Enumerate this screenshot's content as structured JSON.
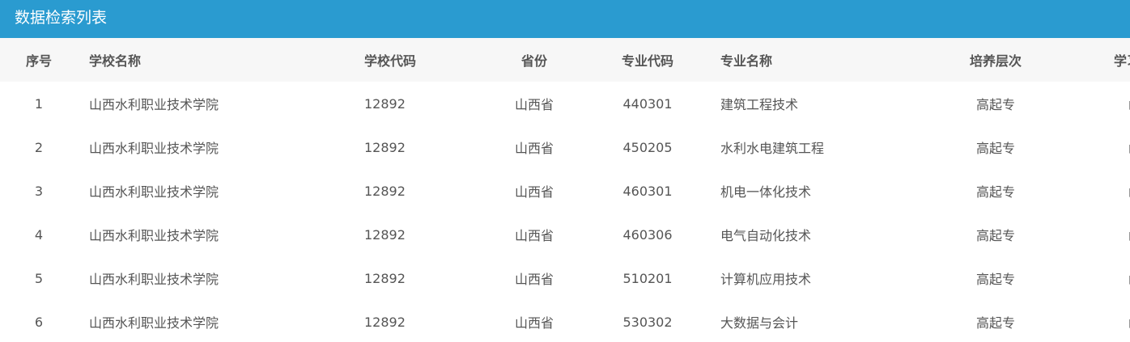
{
  "panel": {
    "title": "数据检索列表"
  },
  "table": {
    "headers": [
      "序号",
      "学校名称",
      "学校代码",
      "省份",
      "专业代码",
      "专业名称",
      "培养层次",
      "学习形式"
    ],
    "rows": [
      [
        "1",
        "山西水利职业技术学院",
        "12892",
        "山西省",
        "440301",
        "建筑工程技术",
        "高起专",
        "函授"
      ],
      [
        "2",
        "山西水利职业技术学院",
        "12892",
        "山西省",
        "450205",
        "水利水电建筑工程",
        "高起专",
        "函授"
      ],
      [
        "3",
        "山西水利职业技术学院",
        "12892",
        "山西省",
        "460301",
        "机电一体化技术",
        "高起专",
        "函授"
      ],
      [
        "4",
        "山西水利职业技术学院",
        "12892",
        "山西省",
        "460306",
        "电气自动化技术",
        "高起专",
        "函授"
      ],
      [
        "5",
        "山西水利职业技术学院",
        "12892",
        "山西省",
        "510201",
        "计算机应用技术",
        "高起专",
        "函授"
      ],
      [
        "6",
        "山西水利职业技术学院",
        "12892",
        "山西省",
        "530302",
        "大数据与会计",
        "高起专",
        "函授"
      ]
    ]
  },
  "colors": {
    "title_bar": "#2a9bd0",
    "header_bg": "#f7f7f7",
    "text": "#555555"
  }
}
